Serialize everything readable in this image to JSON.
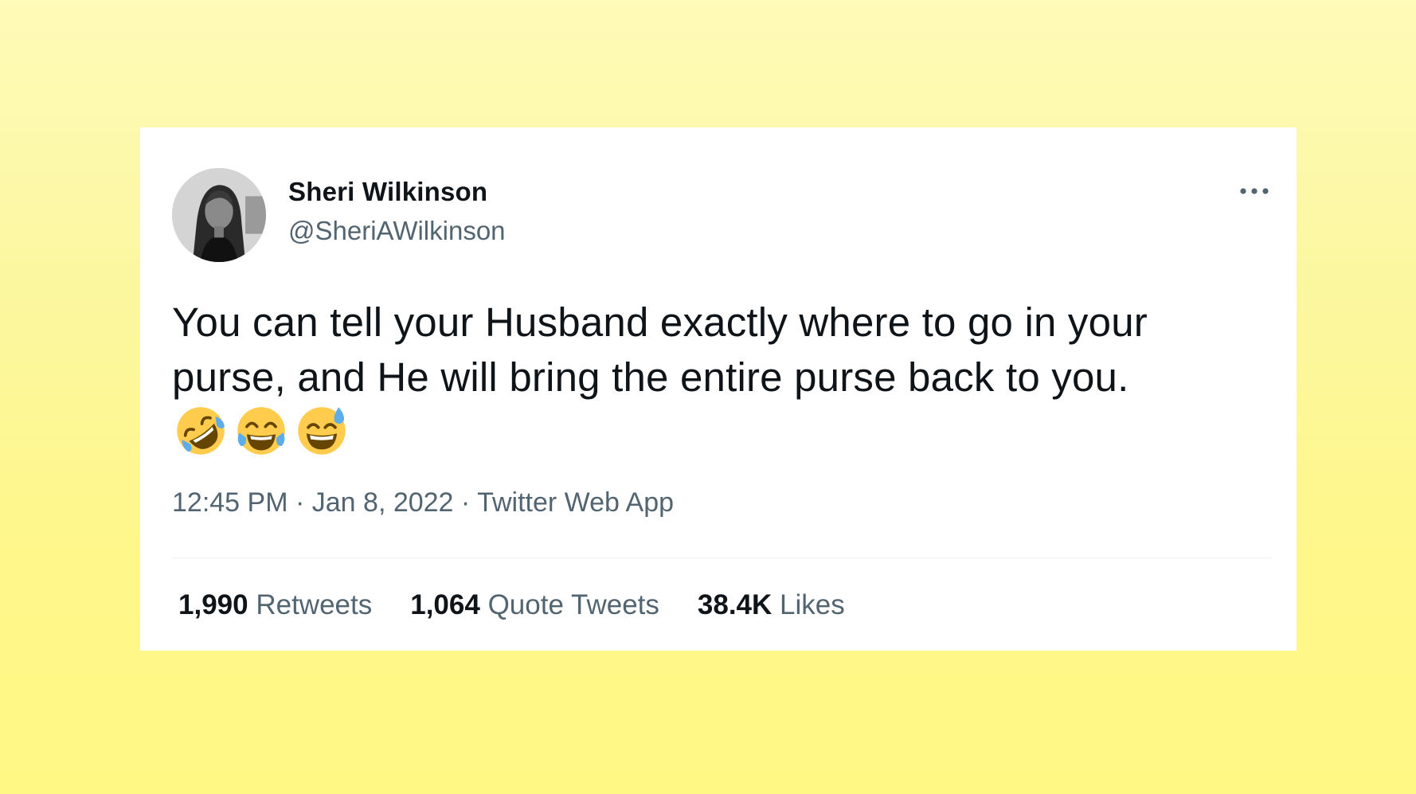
{
  "tweet": {
    "author": {
      "name": "Sheri Wilkinson",
      "handle": "@SheriAWilkinson"
    },
    "text": "You can tell your Husband exactly where to go in your purse, and He will bring the entire purse back to you.",
    "emojis": [
      "rolling-on-floor-laughing",
      "face-with-tears-of-joy",
      "grinning-face-with-sweat"
    ],
    "time": "12:45 PM",
    "date": "Jan 8, 2022",
    "source": "Twitter Web App",
    "separator": "·",
    "stats": {
      "retweets": {
        "count": "1,990",
        "label": "Retweets"
      },
      "quote_tweets": {
        "count": "1,064",
        "label": "Quote Tweets"
      },
      "likes": {
        "count": "38.4K",
        "label": "Likes"
      }
    }
  },
  "colors": {
    "background_top": "#fffbb8",
    "background_bottom": "#fff885",
    "card": "#ffffff",
    "text_primary": "#0f1419",
    "text_secondary": "#536471",
    "divider": "#eff3f4"
  }
}
